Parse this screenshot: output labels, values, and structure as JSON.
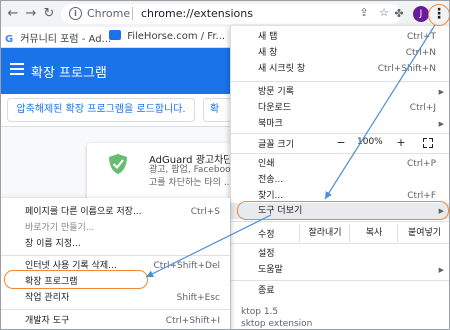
{
  "toolbar": {
    "back_icon": "arrow-left-icon",
    "forward_icon": "arrow-right-icon",
    "reload_icon": "reload-icon",
    "site_label": "Chrome",
    "url": "chrome://extensions",
    "avatar_letter": "J",
    "menu_glyph": "⋮"
  },
  "bookmarks": [
    {
      "label": "커뮤니티 포럼 - Ad..."
    },
    {
      "label": "FileHorse.com / Fr..."
    }
  ],
  "extensions_page": {
    "title": "확장 프로그램",
    "load_unpacked": "압축해제된 확장 프로그램을 로드합니다.",
    "pack_partial": "확",
    "card": {
      "name": "AdGuard 광고차단기",
      "desc1": "광고, 팝업, Facebook",
      "desc2": "고를 차단하는 타의 ..."
    },
    "version_partial": "ktop  1.5",
    "id_partial": "sktop extension"
  },
  "main_menu": {
    "items": [
      {
        "label": "새 탭",
        "shortcut": "Ctrl+T"
      },
      {
        "label": "새 창",
        "shortcut": "Ctrl+N"
      },
      {
        "label": "새 시크릿 창",
        "shortcut": "Ctrl+Shift+N"
      },
      {
        "label": "방문 기록",
        "shortcut": ""
      },
      {
        "label": "다운로드",
        "shortcut": "Ctrl+J"
      },
      {
        "label": "북마크",
        "shortcut": ""
      },
      {
        "label": "인쇄",
        "shortcut": "Ctrl+P"
      },
      {
        "label": "전송...",
        "shortcut": ""
      },
      {
        "label": "찾기...",
        "shortcut": "Ctrl+F"
      },
      {
        "label": "도구 더보기",
        "shortcut": ""
      },
      {
        "label": "설정",
        "shortcut": ""
      },
      {
        "label": "도움말",
        "shortcut": ""
      },
      {
        "label": "종료",
        "shortcut": ""
      }
    ],
    "zoom": {
      "label": "글꼴 크기",
      "minus": "−",
      "value": "100%",
      "plus": "+"
    },
    "edit": {
      "label": "수정",
      "cut": "잘라내기",
      "copy": "복사",
      "paste": "붙여넣기"
    }
  },
  "sub_menu": {
    "items": [
      {
        "label": "페이지를 다른 이름으로 저장...",
        "shortcut": "Ctrl+S"
      },
      {
        "label": "바로가기 만들기...",
        "shortcut": ""
      },
      {
        "label": "창 이름 지정...",
        "shortcut": ""
      },
      {
        "label": "인터넷 사용 기록 삭제...",
        "shortcut": "Ctrl+Shift+Del"
      },
      {
        "label": "확장 프로그램",
        "shortcut": ""
      },
      {
        "label": "작업 관리자",
        "shortcut": "Shift+Esc"
      },
      {
        "label": "개발자 도구",
        "shortcut": "Ctrl+Shift+I"
      }
    ]
  },
  "colors": {
    "accent": "#1a73e8",
    "highlight": "#f08a38",
    "arrow": "#4a90d9"
  }
}
